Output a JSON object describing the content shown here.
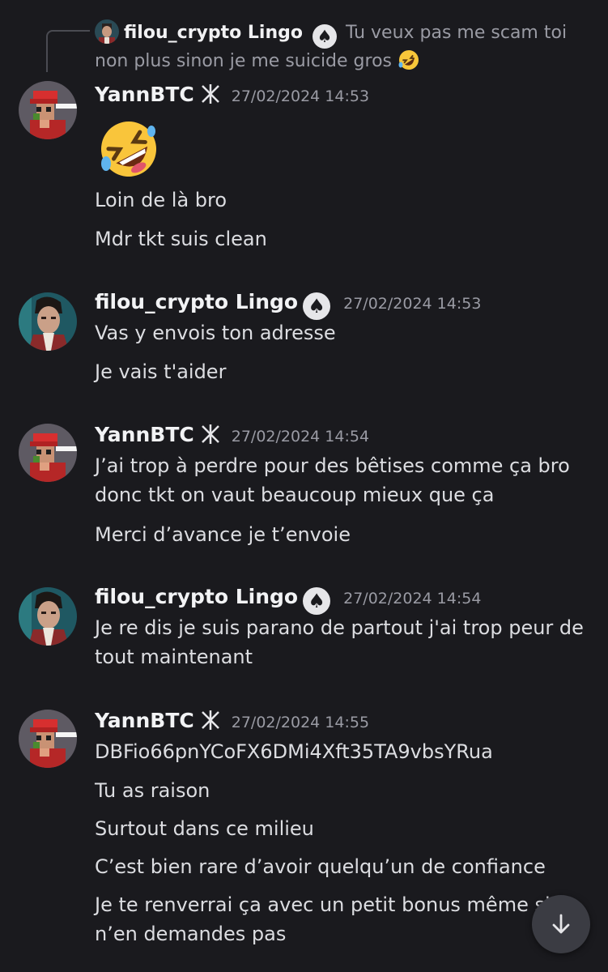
{
  "reply": {
    "author": "filou_crypto Lingo",
    "text": "Tu veux pas me scam toi non plus sinon je me suicide gros",
    "emoji": "rolling-on-floor-laughing-emoji"
  },
  "groups": [
    {
      "author": "YannBTC",
      "timestamp": "27/02/2024 14:53",
      "big_emoji": "rolling-on-floor-laughing-emoji",
      "messages": [
        "Loin de là bro",
        "Mdr tkt suis clean"
      ]
    },
    {
      "author": "filou_crypto Lingo",
      "timestamp": "27/02/2024 14:53",
      "messages": [
        "Vas y envois ton adresse",
        "Je vais t'aider"
      ]
    },
    {
      "author": "YannBTC",
      "timestamp": "27/02/2024 14:54",
      "messages": [
        "J’ai trop à perdre pour des bêtises comme ça bro donc tkt on vaut beaucoup mieux que ça",
        "Merci d’avance je t’envoie"
      ]
    },
    {
      "author": "filou_crypto Lingo",
      "timestamp": "27/02/2024 14:54",
      "messages": [
        "Je re dis je suis parano de partout j'ai trop peur de tout maintenant"
      ]
    },
    {
      "author": "YannBTC",
      "timestamp": "27/02/2024 14:55",
      "messages": [
        "DBFio66pnYCoFX6DMi4Xft35TA9vbsYRua",
        "Tu as raison",
        "Surtout dans ce milieu",
        "C’est bien rare d’avoir quelqu’un de confiance",
        "Je te renverrai ça avec un petit bonus même si tu n’en demandes pas"
      ]
    }
  ],
  "icons": {
    "spade": "♠",
    "scroll": "arrow-down-icon"
  },
  "colors": {
    "background": "#1a1a1e",
    "text": "#dcdde1",
    "muted": "#9a9ba4",
    "username": "#f2f3f5"
  }
}
